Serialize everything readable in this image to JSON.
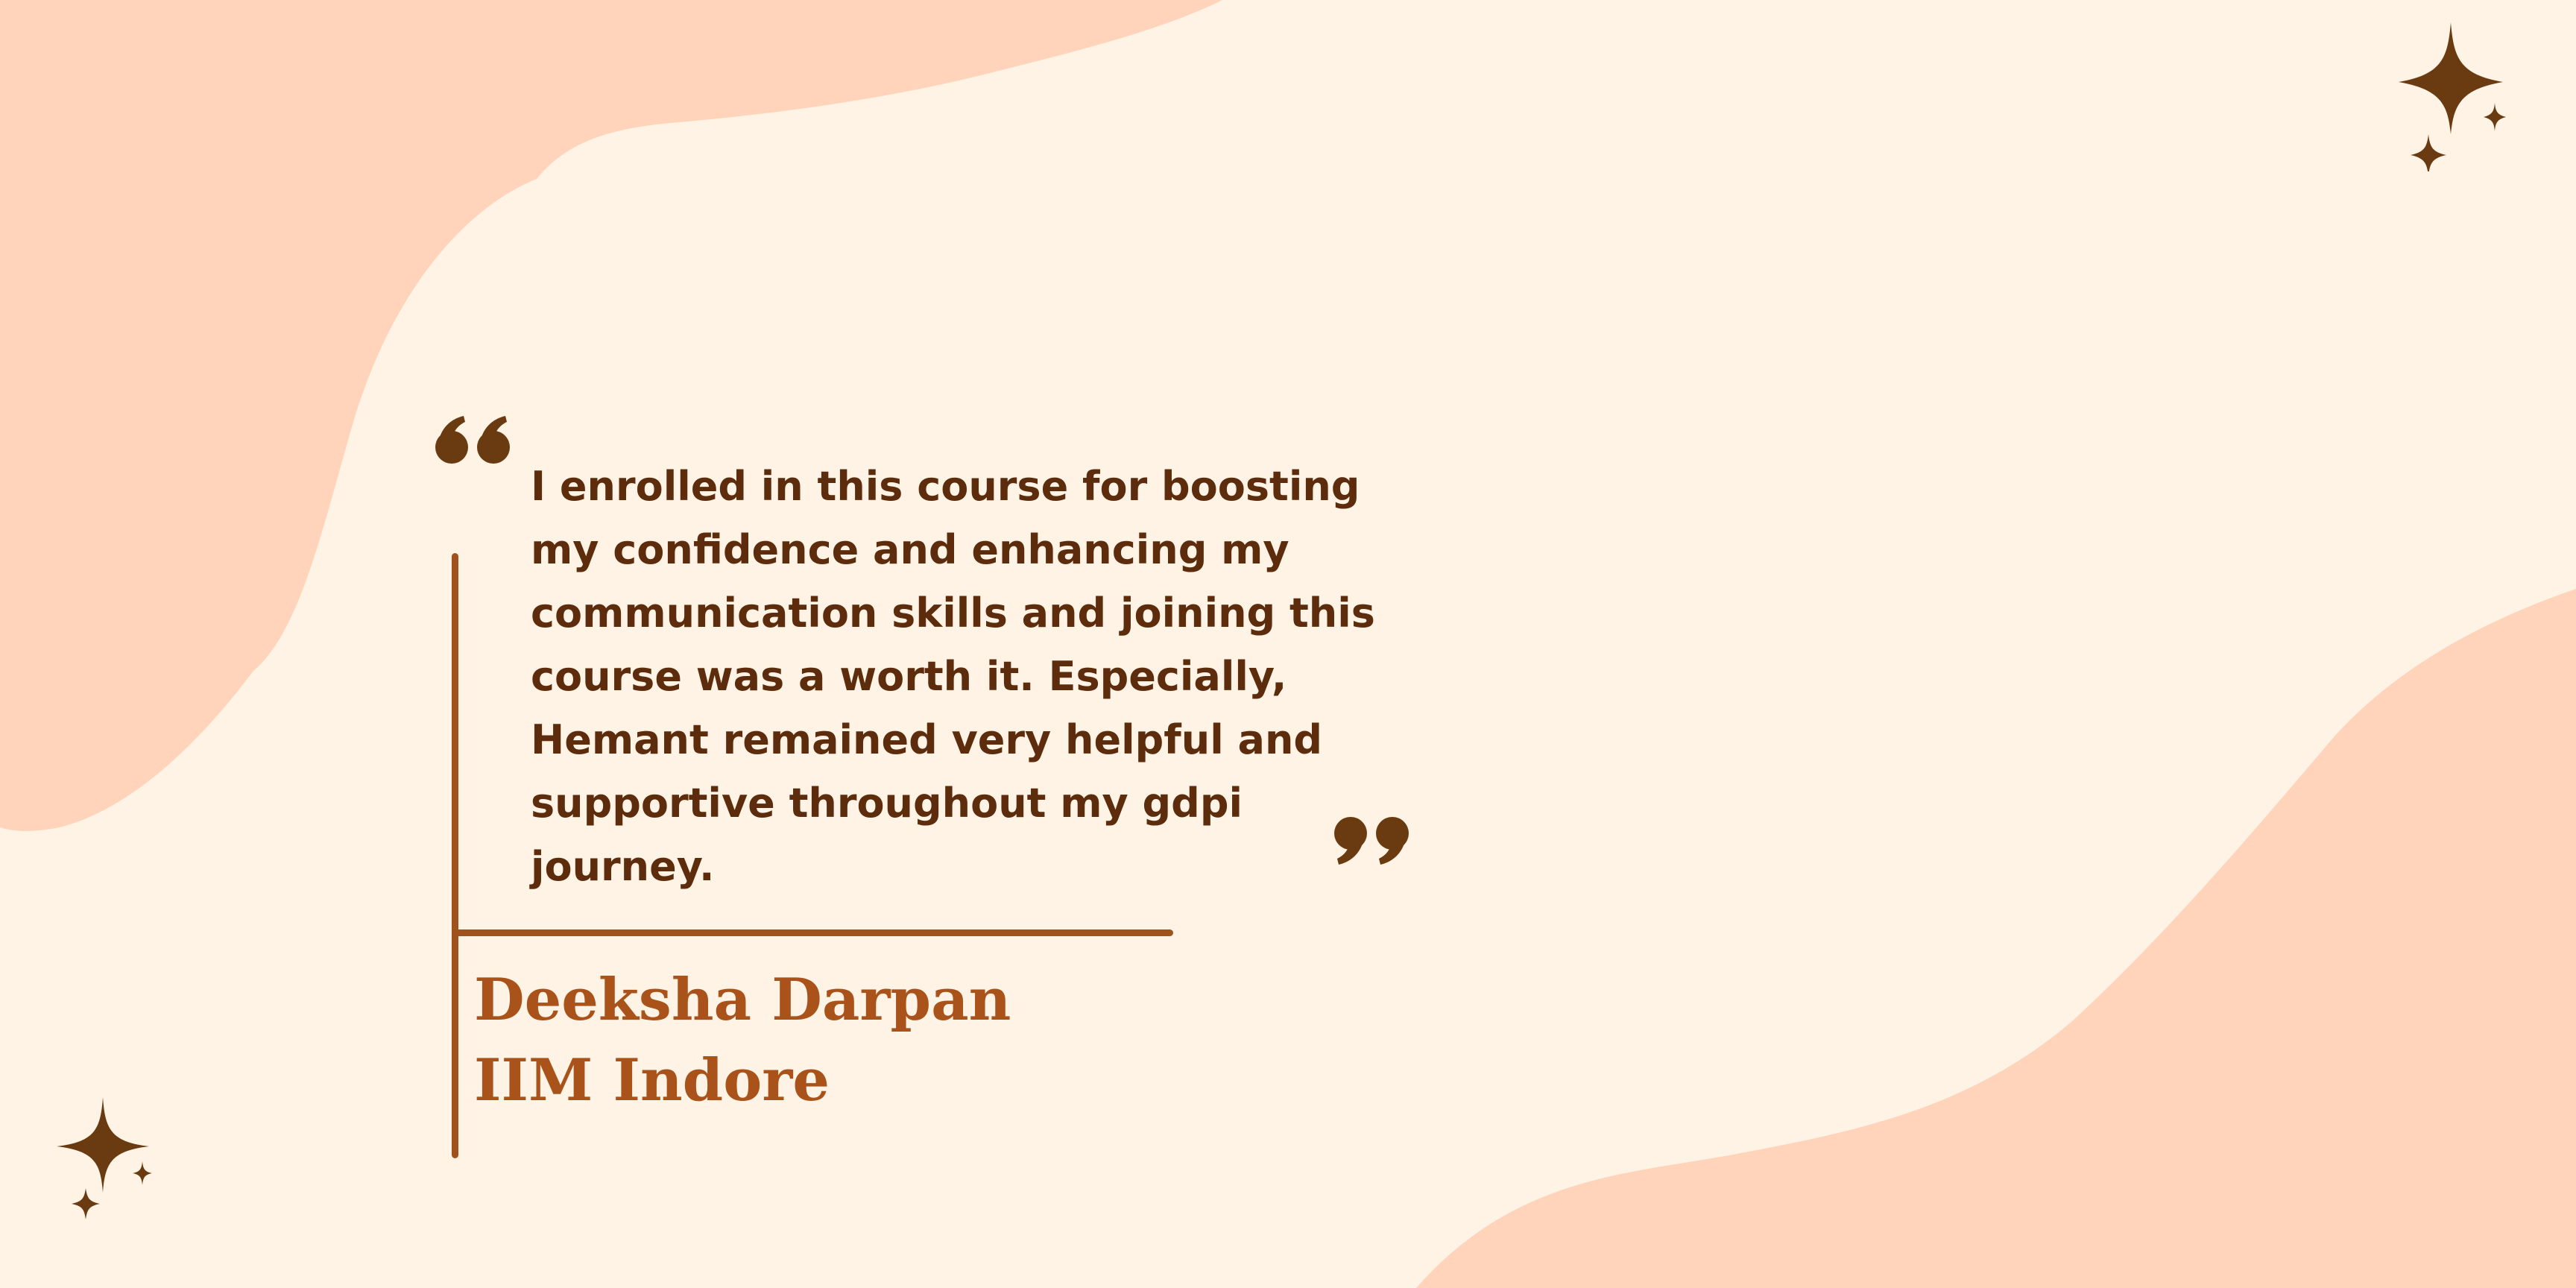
{
  "colors": {
    "background": "#FFF3E5",
    "blob": "#FFD4BA",
    "text_dark": "#5C2C0C",
    "accent": "#A9531B",
    "line": "#A0521C",
    "sparkle": "#6A3A10"
  },
  "testimonial": {
    "quote": "I enrolled in this course for boosting\nmy confidence and enhancing my\ncommunication skills and joining this\ncourse was a worth it. Especially,\nHemant remained very helpful and\nsupportive throughout my gdpi\njourney.",
    "author_name": "Deeksha Darpan",
    "author_institution": "IIM Indore"
  },
  "icons": {
    "open_quote": "opening-quote-icon",
    "close_quote": "closing-quote-icon",
    "sparkle": "sparkle-icon"
  }
}
